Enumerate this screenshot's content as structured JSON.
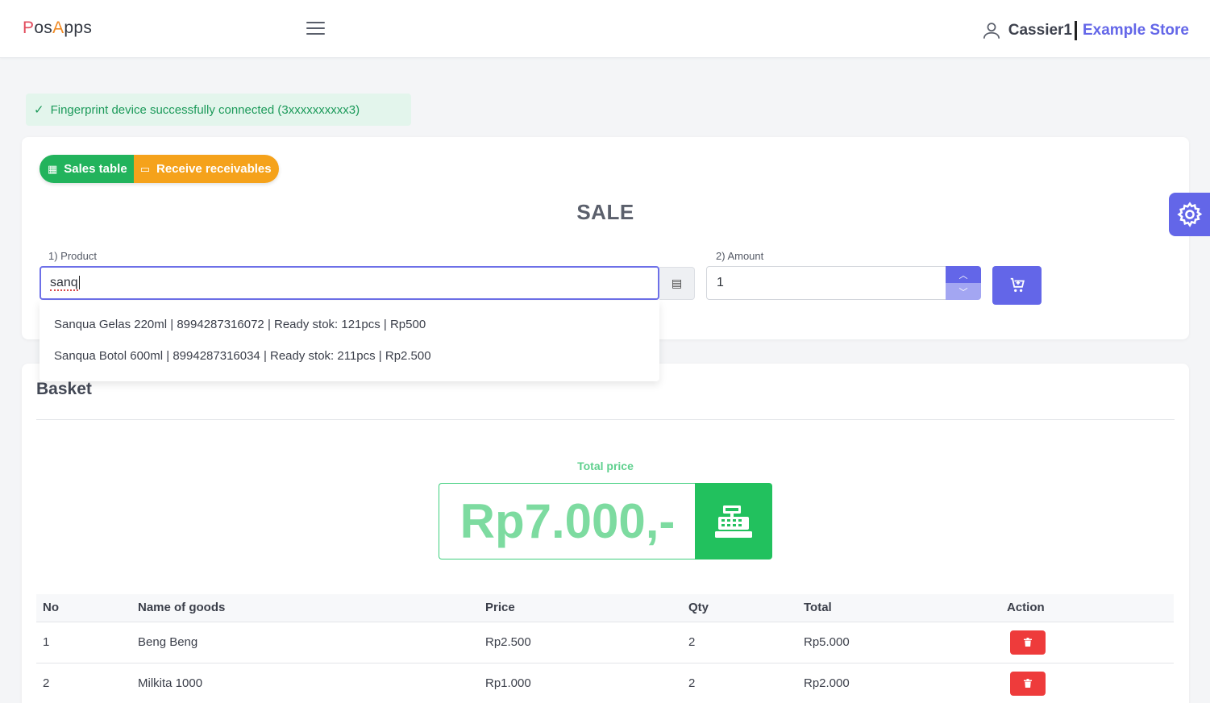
{
  "header": {
    "logo": {
      "part1": "P",
      "part2": "os",
      "part3": "A",
      "part4": "pps"
    },
    "user_name": "Cassier1",
    "store_name": "Example Store"
  },
  "alert": {
    "icon": "check-icon",
    "text": "Fingerprint device successfully connected (3xxxxxxxxxx3)"
  },
  "sale": {
    "sales_table_label": "Sales table",
    "receive_label": "Receive receivables",
    "title": "SALE",
    "product_label": "1) Product",
    "product_value": "sanq",
    "amount_label": "2) Amount",
    "amount_value": "1"
  },
  "suggestions": [
    "Sanqua Gelas 220ml | 8994287316072 | Ready stok: 121pcs | Rp500",
    "Sanqua Botol 600ml | 8994287316034 | Ready stok: 211pcs | Rp2.500"
  ],
  "basket": {
    "title": "Basket",
    "total_label": "Total price",
    "total_value": "Rp7.000,-",
    "columns": [
      "No",
      "Name of goods",
      "Price",
      "Qty",
      "Total",
      "Action"
    ],
    "rows": [
      {
        "no": "1",
        "name": "Beng Beng",
        "price": "Rp2.500",
        "qty": "2",
        "total": "Rp5.000"
      },
      {
        "no": "2",
        "name": "Milkita 1000",
        "price": "Rp1.000",
        "qty": "2",
        "total": "Rp2.000"
      }
    ]
  },
  "colors": {
    "primary": "#6366e8",
    "success": "#22b35c",
    "warning": "#f5a21b",
    "danger": "#ee3b3b"
  }
}
